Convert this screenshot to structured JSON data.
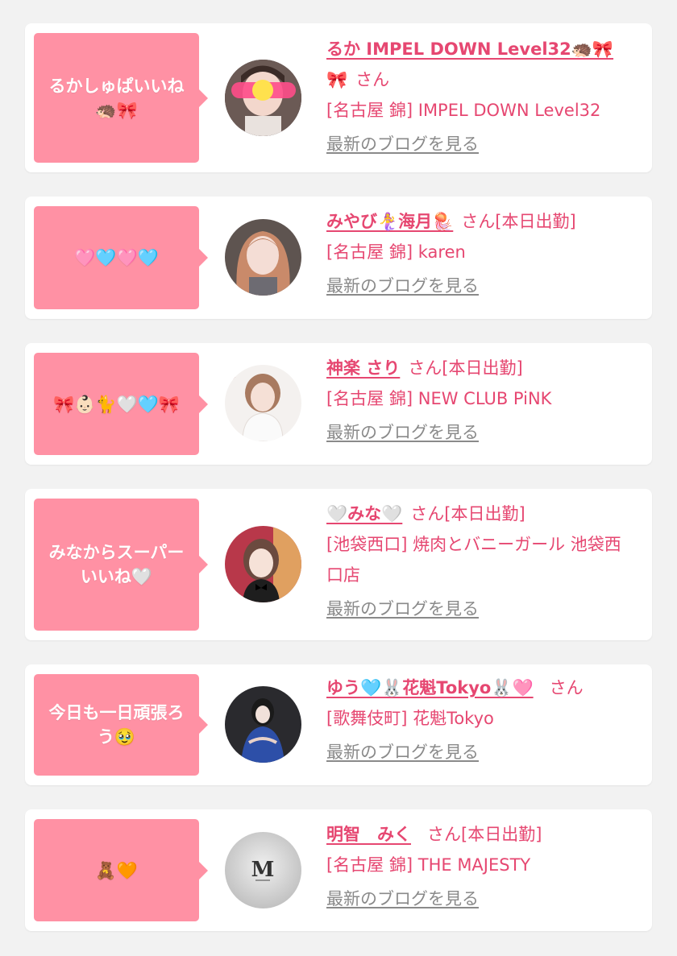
{
  "items": [
    {
      "comment": "るかしゅぱいいね🦔🎀",
      "name": "るか IMPEL DOWN Level32🦔🎀",
      "suffix": "さん",
      "area": "[名古屋 錦]",
      "shop": "IMPEL DOWN Level32",
      "blog_link": "最新のブログを見る",
      "avatar": "avatar-photo-1"
    },
    {
      "comment": "🩷🩵🩷🩵",
      "name": "みやび🧜‍♀️海月🪼",
      "suffix": "さん[本日出勤]",
      "area": "[名古屋 錦]",
      "shop": "karen",
      "blog_link": "最新のブログを見る",
      "avatar": "avatar-photo-2"
    },
    {
      "comment": "🎀👶🏻🐈🤍🩵🎀",
      "name": "神楽 さり",
      "suffix": "さん[本日出勤]",
      "area": "[名古屋 錦]",
      "shop": "NEW CLUB PiNK",
      "blog_link": "最新のブログを見る",
      "avatar": "avatar-photo-3"
    },
    {
      "comment": "みなからスーパーいいね🤍",
      "name": "🤍みな🤍",
      "suffix": "さん[本日出勤]",
      "area": "[池袋西口]",
      "shop": "焼肉とバニーガール 池袋西口店",
      "blog_link": "最新のブログを見る",
      "avatar": "avatar-photo-4"
    },
    {
      "comment": "今日も一日頑張ろう🥹",
      "name": "ゆう🩵🐰花魁Tokyo🐰🩷",
      "suffix": "さん",
      "area": "[歌舞伎町]",
      "shop": "花魁Tokyo",
      "blog_link": "最新のブログを見る",
      "avatar": "avatar-photo-5"
    },
    {
      "comment": "🧸🧡",
      "name": "明智　みく",
      "suffix": "さん[本日出勤]",
      "area": "[名古屋 錦]",
      "shop": "THE MAJESTY",
      "blog_link": "最新のブログを見る",
      "avatar": "avatar-logo-majesty"
    }
  ],
  "colors": {
    "accent": "#e64771",
    "bubble": "#ff91a4",
    "link_gray": "#8a8a8a",
    "background": "#f2f2f2"
  }
}
